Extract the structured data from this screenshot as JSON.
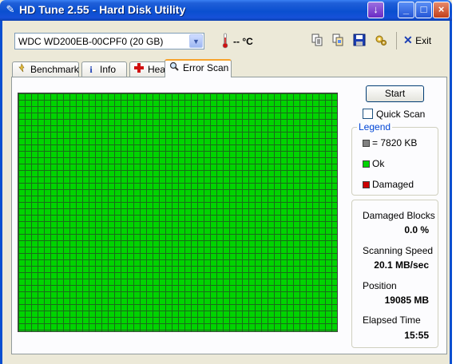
{
  "window": {
    "title": "HD Tune 2.55 - Hard Disk Utility",
    "buttons": {
      "download": "↓",
      "minimize": "_",
      "maximize": "□",
      "close": "×"
    }
  },
  "toolbar": {
    "drive": "WDC WD200EB-00CPF0 (20 GB)",
    "temperature": "-- °C",
    "exit_label": "Exit",
    "icons": [
      "copy-text-icon",
      "copy-screenshot-icon",
      "save-icon",
      "options-icon"
    ]
  },
  "tabs": [
    {
      "label": "Benchmark",
      "icon": "benchmark-icon"
    },
    {
      "label": "Info",
      "icon": "info-icon"
    },
    {
      "label": "Health",
      "icon": "health-icon"
    },
    {
      "label": "Error Scan",
      "icon": "magnifier-icon",
      "active": true
    }
  ],
  "scan": {
    "start_label": "Start",
    "quick_scan_label": "Quick Scan",
    "quick_scan_checked": false
  },
  "legend": {
    "title": "Legend",
    "items": [
      {
        "label": "= 7820 KB",
        "color": "#808080"
      },
      {
        "label": "Ok",
        "color": "#00d400"
      },
      {
        "label": "Damaged",
        "color": "#cc0000"
      }
    ]
  },
  "stats": {
    "damaged_blocks_label": "Damaged Blocks",
    "damaged_blocks_value": "0.0 %",
    "scanning_speed_label": "Scanning Speed",
    "scanning_speed_value": "20.1 MB/sec",
    "position_label": "Position",
    "position_value": "19085 MB",
    "elapsed_time_label": "Elapsed Time",
    "elapsed_time_value": "15:55"
  },
  "colors": {
    "title_bar": "#0a4fd0",
    "ok_block": "#00d400",
    "tab_highlight": "#f7a32c",
    "legend_title": "#0046d5"
  }
}
